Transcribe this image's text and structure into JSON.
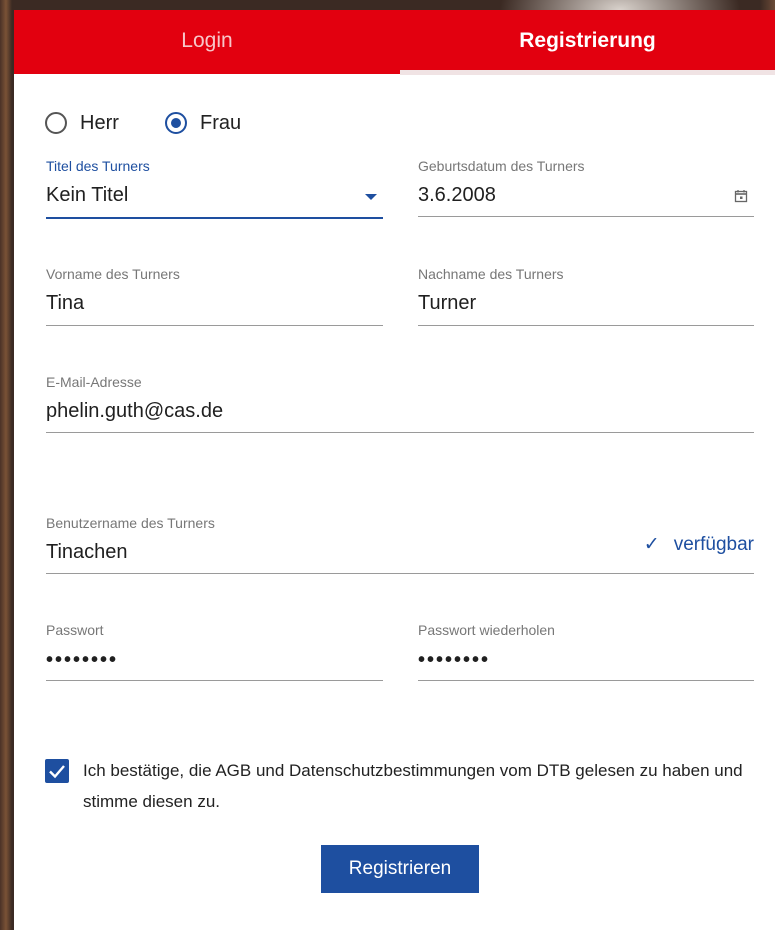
{
  "tabs": {
    "login": "Login",
    "register": "Registrierung"
  },
  "salutation": {
    "herr": "Herr",
    "frau": "Frau",
    "selected": "Frau"
  },
  "fields": {
    "title": {
      "label": "Titel des Turners",
      "value": "Kein Titel"
    },
    "birthdate": {
      "label": "Geburtsdatum des Turners",
      "value": "3.6.2008"
    },
    "firstname": {
      "label": "Vorname des Turners",
      "value": "Tina"
    },
    "lastname": {
      "label": "Nachname des Turners",
      "value": "Turner"
    },
    "email": {
      "label": "E-Mail-Adresse",
      "value": "phelin.guth@cas.de"
    },
    "username": {
      "label": "Benutzername des Turners",
      "value": "Tinachen",
      "status_icon": "✓",
      "status": "verfügbar"
    },
    "password": {
      "label": "Passwort",
      "value": "••••••••"
    },
    "password_repeat": {
      "label": "Passwort wiederholen",
      "value": "••••••••"
    }
  },
  "consent": {
    "checked": true,
    "text": "Ich bestätige, die AGB und Datenschutzbestimmungen vom DTB gelesen zu haben und stimme diesen zu."
  },
  "submit_label": "Registrieren",
  "colors": {
    "brand_red": "#e2000f",
    "accent_blue": "#1e4fa0"
  }
}
